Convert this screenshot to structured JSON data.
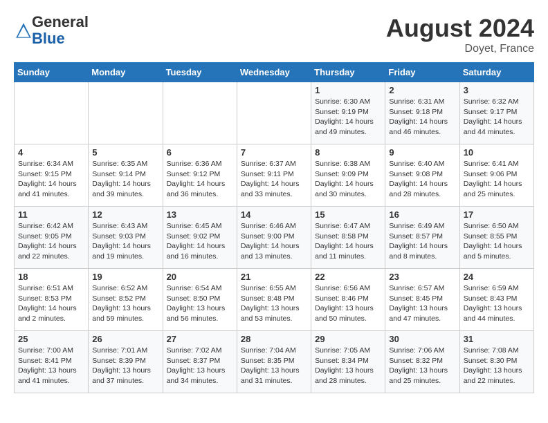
{
  "header": {
    "logo_general": "General",
    "logo_blue": "Blue",
    "month_title": "August 2024",
    "location": "Doyet, France"
  },
  "weekdays": [
    "Sunday",
    "Monday",
    "Tuesday",
    "Wednesday",
    "Thursday",
    "Friday",
    "Saturday"
  ],
  "weeks": [
    [
      {
        "day": "",
        "info": ""
      },
      {
        "day": "",
        "info": ""
      },
      {
        "day": "",
        "info": ""
      },
      {
        "day": "",
        "info": ""
      },
      {
        "day": "1",
        "info": "Sunrise: 6:30 AM\nSunset: 9:19 PM\nDaylight: 14 hours\nand 49 minutes."
      },
      {
        "day": "2",
        "info": "Sunrise: 6:31 AM\nSunset: 9:18 PM\nDaylight: 14 hours\nand 46 minutes."
      },
      {
        "day": "3",
        "info": "Sunrise: 6:32 AM\nSunset: 9:17 PM\nDaylight: 14 hours\nand 44 minutes."
      }
    ],
    [
      {
        "day": "4",
        "info": "Sunrise: 6:34 AM\nSunset: 9:15 PM\nDaylight: 14 hours\nand 41 minutes."
      },
      {
        "day": "5",
        "info": "Sunrise: 6:35 AM\nSunset: 9:14 PM\nDaylight: 14 hours\nand 39 minutes."
      },
      {
        "day": "6",
        "info": "Sunrise: 6:36 AM\nSunset: 9:12 PM\nDaylight: 14 hours\nand 36 minutes."
      },
      {
        "day": "7",
        "info": "Sunrise: 6:37 AM\nSunset: 9:11 PM\nDaylight: 14 hours\nand 33 minutes."
      },
      {
        "day": "8",
        "info": "Sunrise: 6:38 AM\nSunset: 9:09 PM\nDaylight: 14 hours\nand 30 minutes."
      },
      {
        "day": "9",
        "info": "Sunrise: 6:40 AM\nSunset: 9:08 PM\nDaylight: 14 hours\nand 28 minutes."
      },
      {
        "day": "10",
        "info": "Sunrise: 6:41 AM\nSunset: 9:06 PM\nDaylight: 14 hours\nand 25 minutes."
      }
    ],
    [
      {
        "day": "11",
        "info": "Sunrise: 6:42 AM\nSunset: 9:05 PM\nDaylight: 14 hours\nand 22 minutes."
      },
      {
        "day": "12",
        "info": "Sunrise: 6:43 AM\nSunset: 9:03 PM\nDaylight: 14 hours\nand 19 minutes."
      },
      {
        "day": "13",
        "info": "Sunrise: 6:45 AM\nSunset: 9:02 PM\nDaylight: 14 hours\nand 16 minutes."
      },
      {
        "day": "14",
        "info": "Sunrise: 6:46 AM\nSunset: 9:00 PM\nDaylight: 14 hours\nand 13 minutes."
      },
      {
        "day": "15",
        "info": "Sunrise: 6:47 AM\nSunset: 8:58 PM\nDaylight: 14 hours\nand 11 minutes."
      },
      {
        "day": "16",
        "info": "Sunrise: 6:49 AM\nSunset: 8:57 PM\nDaylight: 14 hours\nand 8 minutes."
      },
      {
        "day": "17",
        "info": "Sunrise: 6:50 AM\nSunset: 8:55 PM\nDaylight: 14 hours\nand 5 minutes."
      }
    ],
    [
      {
        "day": "18",
        "info": "Sunrise: 6:51 AM\nSunset: 8:53 PM\nDaylight: 14 hours\nand 2 minutes."
      },
      {
        "day": "19",
        "info": "Sunrise: 6:52 AM\nSunset: 8:52 PM\nDaylight: 13 hours\nand 59 minutes."
      },
      {
        "day": "20",
        "info": "Sunrise: 6:54 AM\nSunset: 8:50 PM\nDaylight: 13 hours\nand 56 minutes."
      },
      {
        "day": "21",
        "info": "Sunrise: 6:55 AM\nSunset: 8:48 PM\nDaylight: 13 hours\nand 53 minutes."
      },
      {
        "day": "22",
        "info": "Sunrise: 6:56 AM\nSunset: 8:46 PM\nDaylight: 13 hours\nand 50 minutes."
      },
      {
        "day": "23",
        "info": "Sunrise: 6:57 AM\nSunset: 8:45 PM\nDaylight: 13 hours\nand 47 minutes."
      },
      {
        "day": "24",
        "info": "Sunrise: 6:59 AM\nSunset: 8:43 PM\nDaylight: 13 hours\nand 44 minutes."
      }
    ],
    [
      {
        "day": "25",
        "info": "Sunrise: 7:00 AM\nSunset: 8:41 PM\nDaylight: 13 hours\nand 41 minutes."
      },
      {
        "day": "26",
        "info": "Sunrise: 7:01 AM\nSunset: 8:39 PM\nDaylight: 13 hours\nand 37 minutes."
      },
      {
        "day": "27",
        "info": "Sunrise: 7:02 AM\nSunset: 8:37 PM\nDaylight: 13 hours\nand 34 minutes."
      },
      {
        "day": "28",
        "info": "Sunrise: 7:04 AM\nSunset: 8:35 PM\nDaylight: 13 hours\nand 31 minutes."
      },
      {
        "day": "29",
        "info": "Sunrise: 7:05 AM\nSunset: 8:34 PM\nDaylight: 13 hours\nand 28 minutes."
      },
      {
        "day": "30",
        "info": "Sunrise: 7:06 AM\nSunset: 8:32 PM\nDaylight: 13 hours\nand 25 minutes."
      },
      {
        "day": "31",
        "info": "Sunrise: 7:08 AM\nSunset: 8:30 PM\nDaylight: 13 hours\nand 22 minutes."
      }
    ]
  ]
}
